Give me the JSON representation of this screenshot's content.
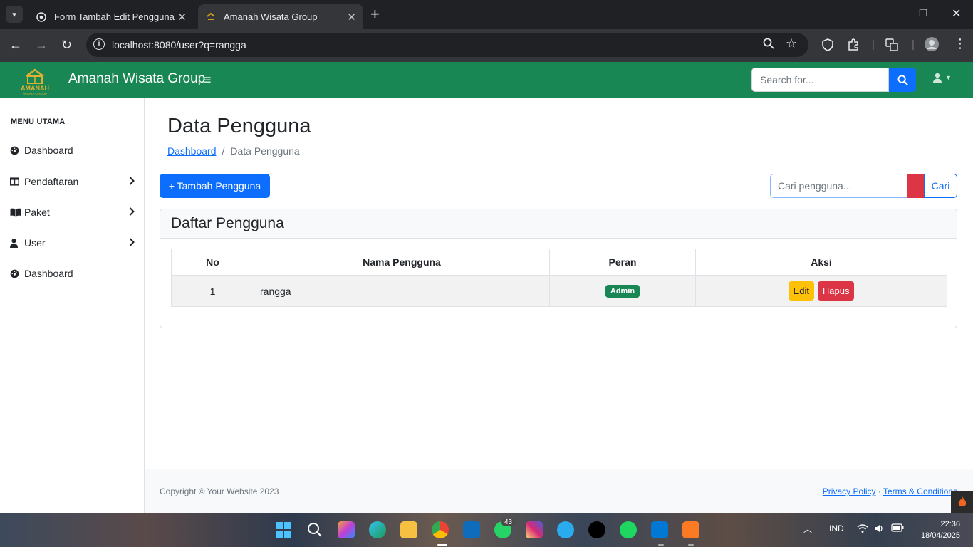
{
  "browser": {
    "tabs": [
      {
        "title": "Form Tambah Edit Pengguna",
        "active": false
      },
      {
        "title": "Amanah Wisata Group",
        "active": true
      }
    ],
    "url": "localhost:8080/user?q=rangga"
  },
  "navbar": {
    "brand": "Amanah Wisata Group",
    "logo_text": "AMANAH",
    "logo_subtext": "WISATA GROUP",
    "search_placeholder": "Search for...",
    "color": "#198754"
  },
  "sidebar": {
    "heading": "MENU UTAMA",
    "items": [
      {
        "label": "Dashboard",
        "icon": "gauge-icon",
        "has_submenu": false
      },
      {
        "label": "Pendaftaran",
        "icon": "columns-icon",
        "has_submenu": true
      },
      {
        "label": "Paket",
        "icon": "book-open-icon",
        "has_submenu": true
      },
      {
        "label": "User",
        "icon": "user-icon",
        "has_submenu": true
      },
      {
        "label": "Dashboard",
        "icon": "gauge-icon",
        "has_submenu": false
      }
    ]
  },
  "main": {
    "title": "Data Pengguna",
    "breadcrumb": {
      "link": "Dashboard",
      "separator": "/",
      "current": "Data Pengguna"
    },
    "add_button": "+ Tambah Pengguna",
    "search_placeholder": "Cari pengguna...",
    "search_button": "Cari",
    "card_title": "Daftar Pengguna",
    "table": {
      "headers": [
        "No",
        "Nama Pengguna",
        "Peran",
        "Aksi"
      ],
      "rows": [
        {
          "no": "1",
          "name": "rangga",
          "role": "Admin",
          "edit": "Edit",
          "delete": "Hapus"
        }
      ]
    }
  },
  "footer": {
    "copyright": "Copyright © Your Website 2023",
    "privacy": "Privacy Policy",
    "separator": "·",
    "terms": "Terms & Conditions"
  },
  "taskbar": {
    "whatsapp_badge": "43",
    "language": "IND",
    "time": "22:36",
    "date": "18/04/2025"
  }
}
